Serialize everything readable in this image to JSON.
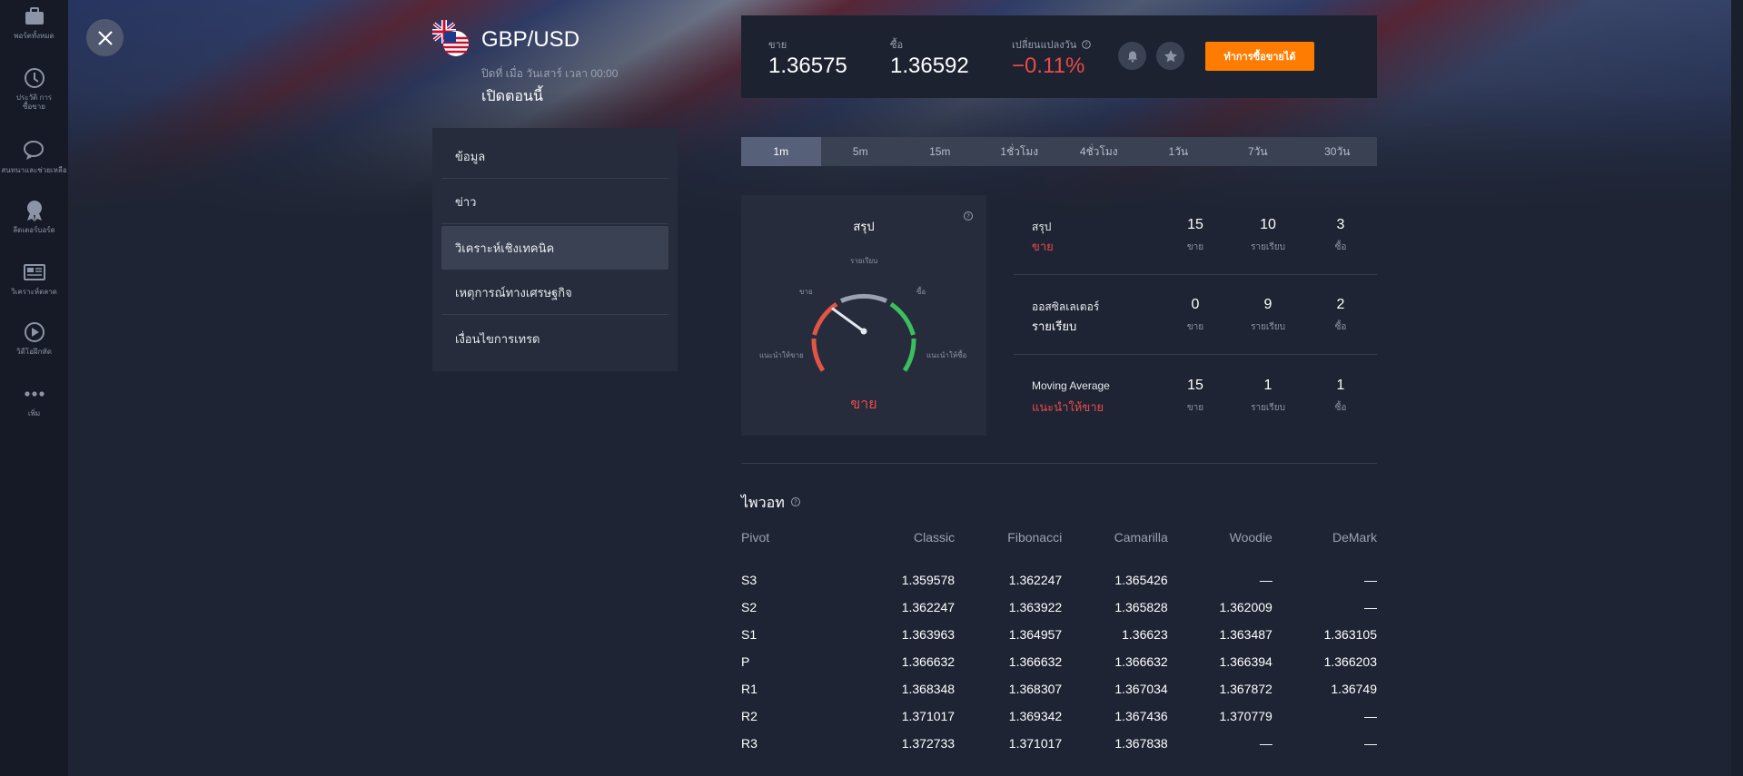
{
  "sidebar": {
    "items": [
      {
        "icon": "briefcase-icon",
        "label": "พอร์ตทั้งหมด"
      },
      {
        "icon": "history-icon",
        "label": "ประวัติ การซื้อขาย"
      },
      {
        "icon": "chat-icon",
        "label": "สนทนาและช่วยเหลือ"
      },
      {
        "icon": "leaderboard-icon",
        "label": "ลีดเดอร์บอร์ด"
      },
      {
        "icon": "news-icon",
        "label": "วิเคราะห์ตลาด"
      },
      {
        "icon": "play-icon",
        "label": "วิดีโอฝึกหัด"
      },
      {
        "icon": "more-icon",
        "label": "เพิ่ม"
      }
    ]
  },
  "header": {
    "asset_name": "GBP/USD",
    "market_info": "ปิดที่ เมื่อ วันเสาร์ เวลา 00:00",
    "status": "เปิดตอนนี้"
  },
  "menu": {
    "items": [
      {
        "label": "ข้อมูล",
        "active": false
      },
      {
        "label": "ข่าว",
        "active": false
      },
      {
        "label": "วิเคราะห์เชิงเทคนิค",
        "active": true
      },
      {
        "label": "เหตุการณ์ทางเศรษฐกิจ",
        "active": false
      },
      {
        "label": "เงื่อนไขการเทรด",
        "active": false
      }
    ]
  },
  "quote": {
    "sell_label": "ขาย",
    "sell_value": "1.36575",
    "buy_label": "ซื้อ",
    "buy_value": "1.36592",
    "change_label": "เปลี่ยนแปลงวัน",
    "change_value": "−0.11%",
    "change_color": "#ea4b4b",
    "trade_button": "ทำการซื้อขายได้"
  },
  "tabs": [
    {
      "label": "1m",
      "active": true
    },
    {
      "label": "5m",
      "active": false
    },
    {
      "label": "15m",
      "active": false
    },
    {
      "label": "1ชั่วโมง",
      "active": false
    },
    {
      "label": "4ชั่วโมง",
      "active": false
    },
    {
      "label": "1วัน",
      "active": false
    },
    {
      "label": "7วัน",
      "active": false
    },
    {
      "label": "30วัน",
      "active": false
    }
  ],
  "gauge": {
    "title": "สรุป",
    "labels": {
      "strong_sell": "แนะนำให้ขาย",
      "sell": "ขาย",
      "neutral": "รายเรียบ",
      "buy": "ซื้อ",
      "strong_buy": "แนะนำให้ซื้อ"
    },
    "result": "ขาย",
    "needle_level": 0.3
  },
  "indicators": [
    {
      "name": "สรุป",
      "verdict": "ขาย",
      "verdict_color": "red",
      "sell": "15",
      "neutral": "10",
      "buy": "3"
    },
    {
      "name": "ออสซิลเลเตอร์",
      "verdict": "รายเรียบ",
      "verdict_color": "white",
      "sell": "0",
      "neutral": "9",
      "buy": "2"
    },
    {
      "name": "Moving Average",
      "verdict": "แนะนำให้ขาย",
      "verdict_color": "red",
      "sell": "15",
      "neutral": "1",
      "buy": "1"
    }
  ],
  "indicator_sub_labels": {
    "sell": "ขาย",
    "neutral": "รายเรียบ",
    "buy": "ซื้อ"
  },
  "pivot": {
    "title": "ไพวอท",
    "headers": [
      "Pivot",
      "Classic",
      "Fibonacci",
      "Camarilla",
      "Woodie",
      "DeMark"
    ],
    "rows": [
      [
        "S3",
        "1.359578",
        "1.362247",
        "1.365426",
        "—",
        "—"
      ],
      [
        "S2",
        "1.362247",
        "1.363922",
        "1.365828",
        "1.362009",
        "—"
      ],
      [
        "S1",
        "1.363963",
        "1.364957",
        "1.36623",
        "1.363487",
        "1.363105"
      ],
      [
        "P",
        "1.366632",
        "1.366632",
        "1.366632",
        "1.366394",
        "1.366203"
      ],
      [
        "R1",
        "1.368348",
        "1.368307",
        "1.367034",
        "1.367872",
        "1.36749"
      ],
      [
        "R2",
        "1.371017",
        "1.369342",
        "1.367436",
        "1.370779",
        "—"
      ],
      [
        "R3",
        "1.372733",
        "1.371017",
        "1.367838",
        "—",
        "—"
      ]
    ]
  }
}
